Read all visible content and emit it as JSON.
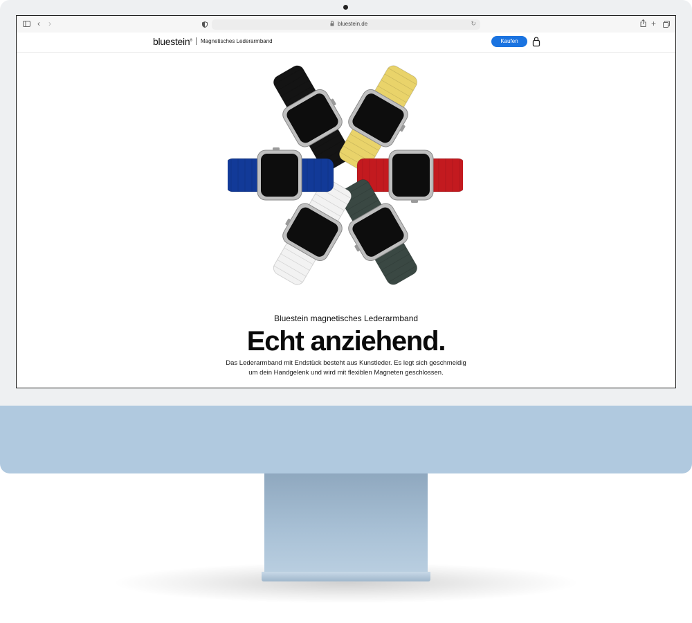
{
  "browser": {
    "url": "bluestein.de"
  },
  "site": {
    "brand": "bluestein",
    "brand_mark": "®",
    "product_title": "Magnetisches Lederarmband",
    "buy_label": "Kaufen"
  },
  "hero": {
    "eyebrow": "Bluestein magnetisches Lederarmband",
    "headline": "Echt anziehend.",
    "body_line1": "Das Lederarmband mit Endstück besteht aus Kunstleder. Es legt sich geschmeidig",
    "body_line2": "um dein Handgelenk und wird mit flexiblen Magneten geschlossen.",
    "band_colors": [
      "#141414",
      "#e9d36a",
      "#c31a1f",
      "#3a4843",
      "#f2f2f2",
      "#123a98"
    ]
  },
  "colors": {
    "accent": "#1a73e0",
    "chin": "#b0c9df"
  },
  "icons": {
    "sidebar": "sidebar-icon",
    "back": "chevron-left-icon",
    "forward": "chevron-right-icon",
    "privacy": "shield-icon",
    "lock": "lock-icon",
    "reload": "reload-icon",
    "share": "share-icon",
    "new_tab": "plus-icon",
    "tabs": "tabs-overview-icon",
    "bag": "shopping-bag-icon"
  }
}
